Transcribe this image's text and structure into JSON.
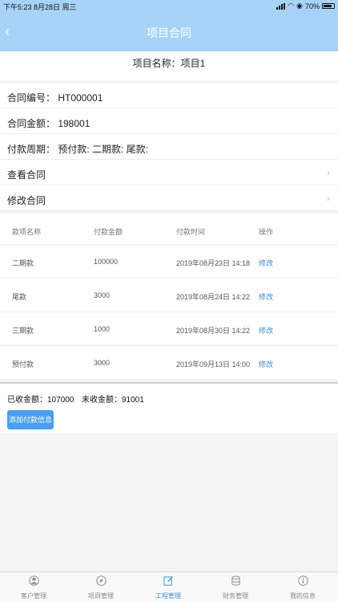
{
  "status_bar": {
    "time_date": "下午5:23  8月28日 周三",
    "battery": "70%"
  },
  "nav": {
    "back_icon": "chevron-left-icon",
    "title": "项目合同"
  },
  "project": {
    "label": "项目名称：项目1"
  },
  "contract": {
    "number": "合同编号：  HT000001",
    "amount": "合同金额：  198001",
    "terms": "付款周期：  预付款: 二期款: 尾款:",
    "view": "查看合同",
    "edit": "修改合同"
  },
  "table": {
    "headers": [
      "款项名称",
      "付款金额",
      "付款时间",
      "操作"
    ],
    "rows": [
      {
        "name": "二期款",
        "amount": "100000",
        "time": "2019年08月23日 14:18",
        "action": "修改"
      },
      {
        "name": "尾款",
        "amount": "3000",
        "time": "2019年08月24日 14:22",
        "action": "修改"
      },
      {
        "name": "三期款",
        "amount": "1000",
        "time": "2019年08月30日 14:22",
        "action": "修改"
      },
      {
        "name": "预付款",
        "amount": "3000",
        "time": "2019年09月13日 14:00",
        "action": "修改"
      }
    ]
  },
  "summary": {
    "received": "已收金额：107000",
    "unreceived": "未收金额：91001",
    "add_button": "添加付款信息"
  },
  "tabs": [
    {
      "label": "客户管理",
      "icon": "person-icon"
    },
    {
      "label": "项目管理",
      "icon": "compass-icon"
    },
    {
      "label": "工程管理",
      "icon": "edit-icon"
    },
    {
      "label": "财务管理",
      "icon": "database-icon"
    },
    {
      "label": "我的信息",
      "icon": "info-icon"
    }
  ],
  "colors": {
    "nav_bg": "#a8d3f8",
    "accent": "#3d8de0",
    "button": "#4a9ff0"
  }
}
